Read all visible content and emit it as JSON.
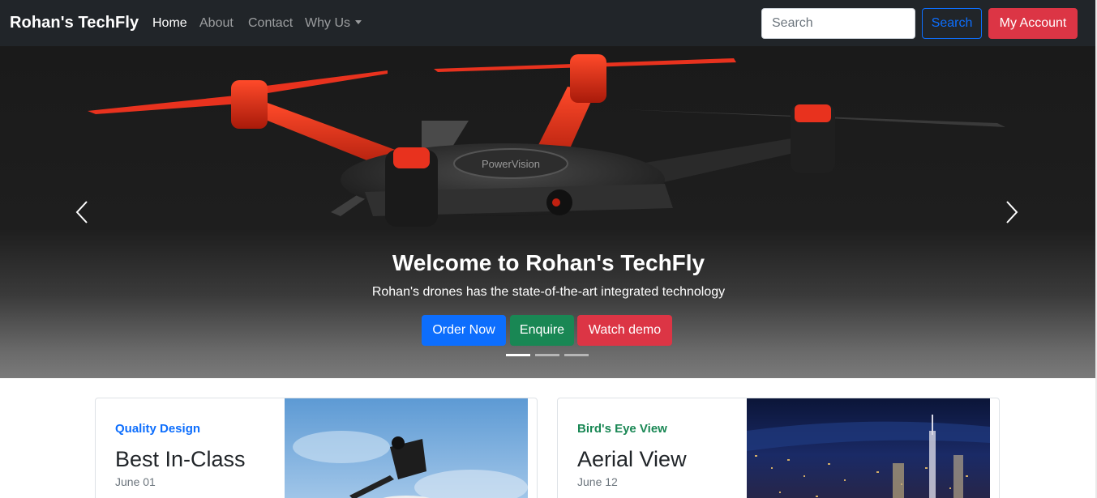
{
  "navbar": {
    "brand": "Rohan's TechFly",
    "links": [
      {
        "label": "Home",
        "active": true
      },
      {
        "label": "About",
        "active": false
      },
      {
        "label": "Contact",
        "active": false
      },
      {
        "label": "Why Us",
        "active": false,
        "dropdown": true
      }
    ],
    "search": {
      "placeholder": "Search",
      "value": ""
    },
    "search_button": "Search",
    "account_button": "My Account"
  },
  "carousel": {
    "title": "Welcome to Rohan's TechFly",
    "subtitle": "Rohan's drones has the state-of-the-art integrated technology",
    "buttons": {
      "order": "Order Now",
      "enquire": "Enquire",
      "demo": "Watch demo"
    },
    "slide_count": 3,
    "active_slide": 1,
    "drone_label": "PowerVision"
  },
  "cards": [
    {
      "category": "Quality Design",
      "title": "Best In-Class",
      "date": "June 01"
    },
    {
      "category": "Bird's Eye View",
      "title": "Aerial View",
      "date": "June 12"
    }
  ],
  "colors": {
    "primary": "#0d6efd",
    "success": "#198754",
    "danger": "#dc3545",
    "dark": "#212529",
    "drone_accent": "#e8321e"
  }
}
